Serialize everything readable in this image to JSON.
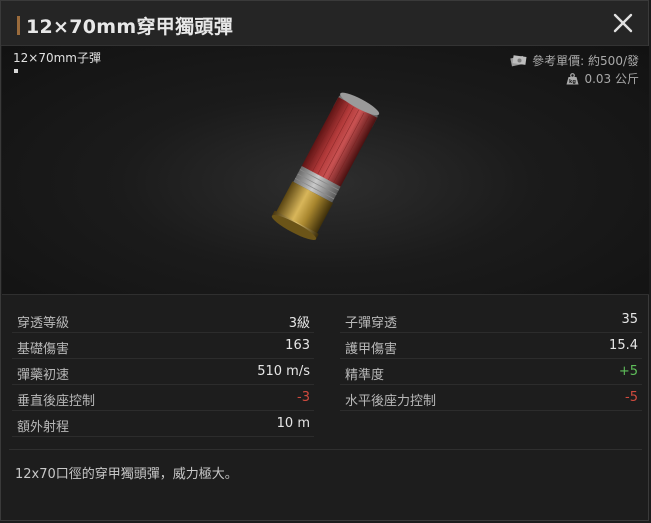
{
  "window": {
    "title": "12×70mm穿甲獨頭彈",
    "close_icon": "close-icon"
  },
  "item": {
    "caliber_label": "12×70mm子彈",
    "price_label": "參考單價:",
    "price_value": "約500/發",
    "weight": "0.03 公斤",
    "price_icon": "money-icon",
    "weight_icon": "weight-icon",
    "image": "shotgun-shell"
  },
  "stats": {
    "left": [
      {
        "label": "穿透等級",
        "value": "3級",
        "tone": "normal"
      },
      {
        "label": "基礎傷害",
        "value": "163",
        "tone": "normal"
      },
      {
        "label": "彈藥初速",
        "value": "510 m/s",
        "tone": "normal"
      },
      {
        "label": "垂直後座控制",
        "value": "-3",
        "tone": "negative"
      },
      {
        "label": "額外射程",
        "value": "10 m",
        "tone": "normal"
      }
    ],
    "right": [
      {
        "label": "子彈穿透",
        "value": "35",
        "tone": "normal"
      },
      {
        "label": "護甲傷害",
        "value": "15.4",
        "tone": "normal"
      },
      {
        "label": "精準度",
        "value": "+5",
        "tone": "positive"
      },
      {
        "label": "水平後座力控制",
        "value": "-5",
        "tone": "negative"
      }
    ]
  },
  "description": "12x70口徑的穿甲獨頭彈，威力極大。",
  "colors": {
    "accent": "#9a6b3c",
    "positive": "#5fbf5a",
    "negative": "#d04a3e"
  }
}
